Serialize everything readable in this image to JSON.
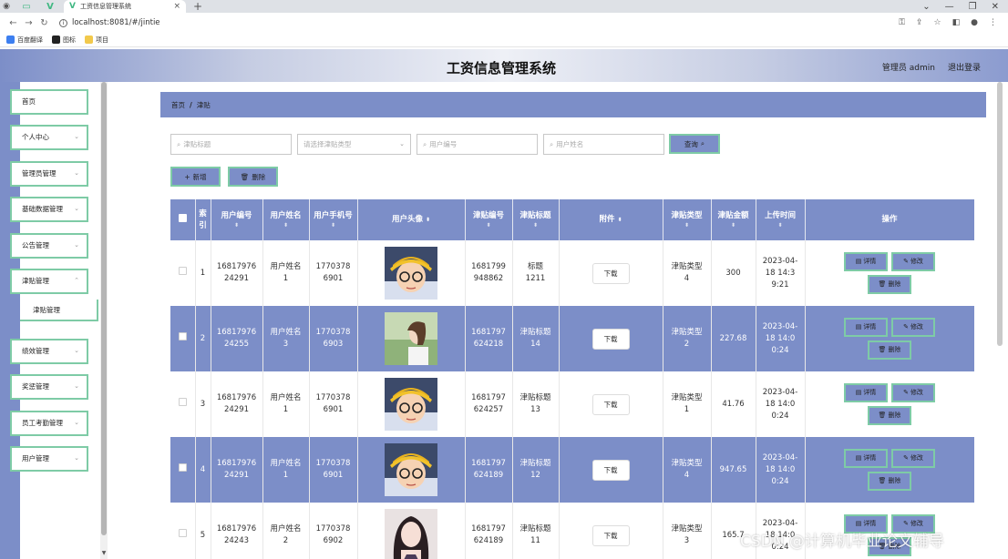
{
  "browser": {
    "tab_title": "工资信息管理系统",
    "url": "localhost:8081/#/jintie",
    "bookmarks": [
      "百度翻译",
      "图标",
      "项目"
    ]
  },
  "header": {
    "title": "工资信息管理系统",
    "admin": "管理员 admin",
    "logout": "退出登录"
  },
  "sidebar": {
    "items": [
      "首页",
      "个人中心",
      "管理员管理",
      "基础数据管理",
      "公告管理",
      "津贴管理",
      "绩效管理",
      "奖惩管理",
      "员工考勤管理",
      "用户管理"
    ],
    "sub_item": "津贴管理"
  },
  "breadcrumb": {
    "home": "首页",
    "sep": "/",
    "current": "津贴"
  },
  "search": {
    "title_placeholder": "津贴标题",
    "type_placeholder": "请选择津贴类型",
    "user_no_placeholder": "用户编号",
    "user_name_placeholder": "用户姓名",
    "query_label": "查询"
  },
  "actions": {
    "add_label": "新增",
    "delete_label": "删除"
  },
  "table": {
    "headers": [
      "索引",
      "用户编号",
      "用户姓名",
      "用户手机号",
      "用户头像",
      "津贴编号",
      "津贴标题",
      "附件",
      "津贴类型",
      "津贴金额",
      "上传时间",
      "操作"
    ],
    "download_label": "下载",
    "detail_label": "详情",
    "edit_label": "修改",
    "delete_label": "删除",
    "rows": [
      {
        "index": "1",
        "user_no": "1681797624291",
        "user_name": "用户姓名1",
        "phone": "17703786901",
        "allowance_no": "1681799948862",
        "title": "标题1211",
        "type": "津贴类型4",
        "amount": "300",
        "time": "2023-04-18 14:39:21"
      },
      {
        "index": "2",
        "user_no": "1681797624255",
        "user_name": "用户姓名3",
        "phone": "17703786903",
        "allowance_no": "1681797624218",
        "title": "津贴标题14",
        "type": "津贴类型2",
        "amount": "227.68",
        "time": "2023-04-18 14:00:24"
      },
      {
        "index": "3",
        "user_no": "1681797624291",
        "user_name": "用户姓名1",
        "phone": "17703786901",
        "allowance_no": "1681797624257",
        "title": "津贴标题13",
        "type": "津贴类型1",
        "amount": "41.76",
        "time": "2023-04-18 14:00:24"
      },
      {
        "index": "4",
        "user_no": "1681797624291",
        "user_name": "用户姓名1",
        "phone": "17703786901",
        "allowance_no": "1681797624189",
        "title": "津贴标题12",
        "type": "津贴类型4",
        "amount": "947.65",
        "time": "2023-04-18 14:00:24"
      },
      {
        "index": "5",
        "user_no": "1681797624243",
        "user_name": "用户姓名2",
        "phone": "17703786902",
        "allowance_no": "1681797624189",
        "title": "津贴标题11",
        "type": "津贴类型3",
        "amount": "165.7",
        "time": "2023-04-18 14:00:24"
      }
    ]
  },
  "watermark": "CSDN @计算机毕业论文辅导",
  "colors": {
    "accent": "#7c8ec8",
    "border_accent": "#7ecba6"
  }
}
